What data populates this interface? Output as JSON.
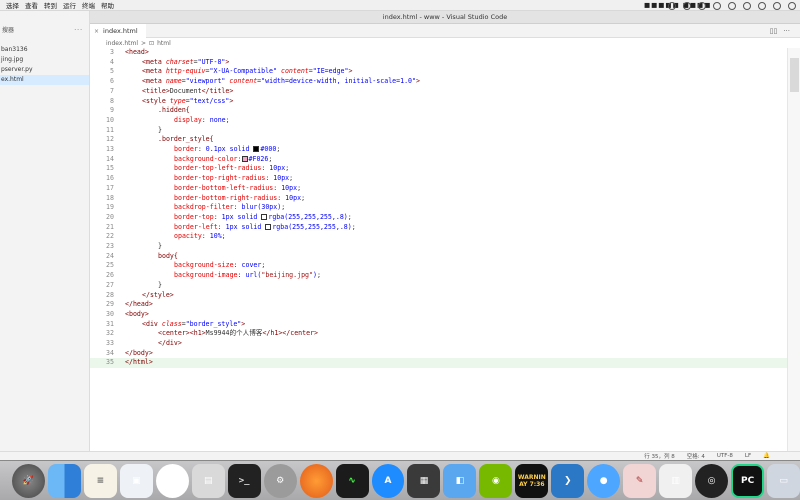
{
  "menubar": {
    "items": [
      "选择",
      "查看",
      "转到",
      "运行",
      "终端",
      "帮助"
    ],
    "clock": "■■■■■ ■■■■"
  },
  "window": {
    "title": "index.html - www - Visual Studio Code"
  },
  "sidebar": {
    "header": "搜器",
    "more": "···",
    "files": [
      {
        "label": "ban3136",
        "active": false
      },
      {
        "label": "jing.jpg",
        "active": false
      },
      {
        "label": "pserver.py",
        "active": false
      },
      {
        "label": "ex.html",
        "active": true
      }
    ]
  },
  "tab": {
    "label": "index.html",
    "close": "×"
  },
  "breadcrumb": {
    "file": "index.html",
    "sep": ">",
    "node": "html"
  },
  "editor": {
    "lines": [
      {
        "n": "3"
      },
      {
        "n": "4"
      },
      {
        "n": "5"
      },
      {
        "n": "6"
      },
      {
        "n": "7"
      },
      {
        "n": "8"
      },
      {
        "n": "9"
      },
      {
        "n": "10"
      },
      {
        "n": "11"
      },
      {
        "n": "12"
      },
      {
        "n": "13"
      },
      {
        "n": "14"
      },
      {
        "n": "15"
      },
      {
        "n": "16"
      },
      {
        "n": "17"
      },
      {
        "n": "18"
      },
      {
        "n": "19"
      },
      {
        "n": "20"
      },
      {
        "n": "21"
      },
      {
        "n": "22"
      },
      {
        "n": "23"
      },
      {
        "n": "24"
      },
      {
        "n": "25"
      },
      {
        "n": "26"
      },
      {
        "n": "27"
      },
      {
        "n": "28"
      },
      {
        "n": "29"
      },
      {
        "n": "30"
      },
      {
        "n": "31"
      },
      {
        "n": "32"
      },
      {
        "n": "33"
      },
      {
        "n": "34"
      },
      {
        "n": "35"
      }
    ],
    "current_line": "35",
    "swatch_colors": {
      "black": "#000",
      "pink": "#F026",
      "white": "rgba(255,255,255,.8)"
    }
  },
  "code": {
    "l3": "<head>",
    "l4_tag": "<meta ",
    "l4_attr": "charset",
    "l4_val": "\"UTF-8\"",
    "l4_end": ">",
    "l5_tag": "<meta ",
    "l5_attr": "http-equiv",
    "l5_val": "\"X-UA-Compatible\"",
    "l5_attr2": " content",
    "l5_val2": "\"IE=edge\"",
    "l5_end": ">",
    "l6_tag": "<meta ",
    "l6_attr": "name",
    "l6_val": "\"viewport\"",
    "l6_attr2": " content",
    "l6_val2": "\"width=device-width, initial-scale=1.0\"",
    "l6_end": ">",
    "l7_open": "<title>",
    "l7_text": "Document",
    "l7_close": "</title>",
    "l8_tag": "<style ",
    "l8_attr": "type",
    "l8_val": "\"text/css\"",
    "l8_end": ">",
    "l9": ".hidden{",
    "l10_prop": "display",
    "l10_val": "none",
    "l11": "}",
    "l12": ".border_style{",
    "l13_prop": "border",
    "l13_val1": "0.1px solid ",
    "l13_val2": "#000",
    "l14_prop": "background-color",
    "l14_val": "#F026",
    "l15_prop": "border-top-left-radius",
    "l15_val": "10px",
    "l16_prop": "border-top-right-radius",
    "l16_val": "10px",
    "l17_prop": "border-bottom-left-radius",
    "l17_val": "10px",
    "l18_prop": "border-bottom-right-radius",
    "l18_val": "10px",
    "l19_prop": "backdrop-filter",
    "l19_val": "blur(30px)",
    "l20_prop": "border-top",
    "l20_val1": "1px solid ",
    "l20_val2": "rgba(255,255,255,.8)",
    "l21_prop": "border-left",
    "l21_val1": "1px solid ",
    "l21_val2": "rgba(255,255,255,.8)",
    "l22_prop": "opacity",
    "l22_val": "10%",
    "l23": "}",
    "l24": "body{",
    "l25_prop": "background-size",
    "l25_val": "cover",
    "l26_prop": "background-image",
    "l26_val1": "url(",
    "l26_str": "\"beijing.jpg\"",
    "l26_val2": ")",
    "l27": "}",
    "l28": "</style>",
    "l29": "</head>",
    "l30": "<body>",
    "l31_tag": "<div ",
    "l31_attr": "class",
    "l31_val": "\"border_style\"",
    "l31_end": ">",
    "l32_open": "<center><h1>",
    "l32_text": "Ms9944的个人博客",
    "l32_close": "</h1></center>",
    "l33": "</div>",
    "l34": "</body>",
    "l35": "</html>"
  },
  "statusbar": {
    "position": "行 35，列 8",
    "spaces": "空格: 4",
    "encoding": "UTF-8",
    "eol": "LF"
  },
  "dock": {
    "apps": [
      {
        "name": "launchpad-rocket-icon",
        "text": ""
      },
      {
        "name": "finder-icon",
        "text": ""
      },
      {
        "name": "notes-icon",
        "text": ""
      },
      {
        "name": "preview-icon",
        "text": ""
      },
      {
        "name": "photos-icon",
        "text": ""
      },
      {
        "name": "image-capture-icon",
        "text": ""
      },
      {
        "name": "terminal-icon",
        "text": ">_"
      },
      {
        "name": "system-preferences-icon",
        "text": ""
      },
      {
        "name": "firefox-icon",
        "text": ""
      },
      {
        "name": "activity-monitor-icon",
        "text": ""
      },
      {
        "name": "app-store-icon",
        "text": "A"
      },
      {
        "name": "books-icon",
        "text": ""
      },
      {
        "name": "preview2-icon",
        "text": ""
      },
      {
        "name": "nvidia-icon",
        "text": ""
      },
      {
        "name": "console-icon",
        "text": "WARNIN\nAY 7:36"
      },
      {
        "name": "vscode-icon",
        "text": ""
      },
      {
        "name": "messages-icon",
        "text": ""
      },
      {
        "name": "textedit-icon",
        "text": ""
      },
      {
        "name": "gallery-icon",
        "text": ""
      },
      {
        "name": "obs-icon",
        "text": ""
      },
      {
        "name": "pycharm-icon",
        "text": "PC"
      },
      {
        "name": "display-icon",
        "text": ""
      }
    ]
  }
}
